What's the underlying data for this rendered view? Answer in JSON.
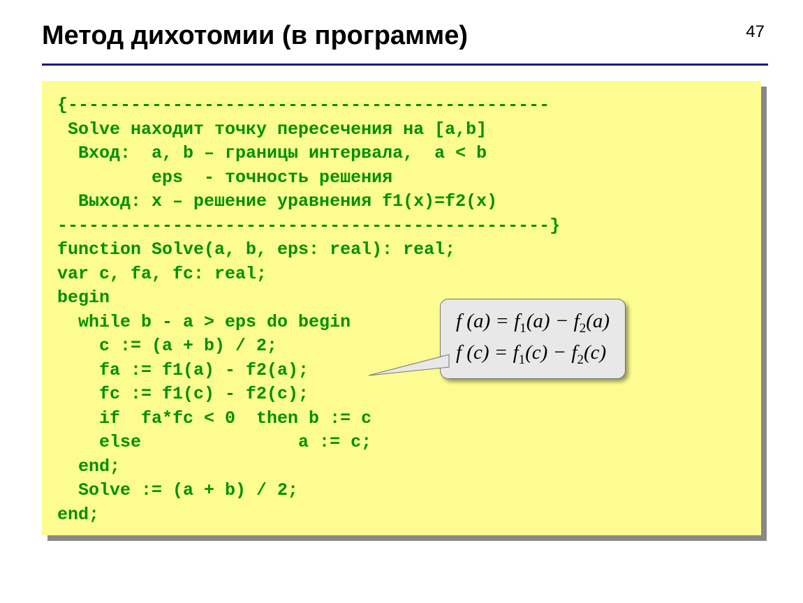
{
  "page_number": "47",
  "title": "Метод дихотомии (в программе)",
  "code": {
    "l01": "{----------------------------------------------",
    "l02": " Solve находит точку пересечения на [a,b]",
    "l03": "  Вход:  a, b – границы интервала,  a < b",
    "l04": "         eps  - точность решения",
    "l05": "  Выход: x – решение уравнения f1(x)=f2(x)",
    "l06": "-----------------------------------------------}",
    "l07": "function Solve(a, b, eps: real): real;",
    "l08": "var c, fa, fc: real;",
    "l09": "begin",
    "l10": "  while b - a > eps do begin",
    "l11": "    c := (a + b) / 2;",
    "l12": "    fa := f1(a) - f2(a);",
    "l13": "    fc := f1(c) - f2(c);",
    "l14": "    if  fa*fc < 0  then b := c",
    "l15": "    else               a := c;",
    "l16": "  end;",
    "l17": "  Solve := (a + b) / 2;",
    "l18": "end;"
  },
  "callout": {
    "line1_prefix": "f (a) = f",
    "line1_sub1": "1",
    "line1_mid": "(a) − f",
    "line1_sub2": "2",
    "line1_suffix": "(a)",
    "line2_prefix": "f (c) = f",
    "line2_sub1": "1",
    "line2_mid": "(c) − f",
    "line2_sub2": "2",
    "line2_suffix": "(c)"
  }
}
